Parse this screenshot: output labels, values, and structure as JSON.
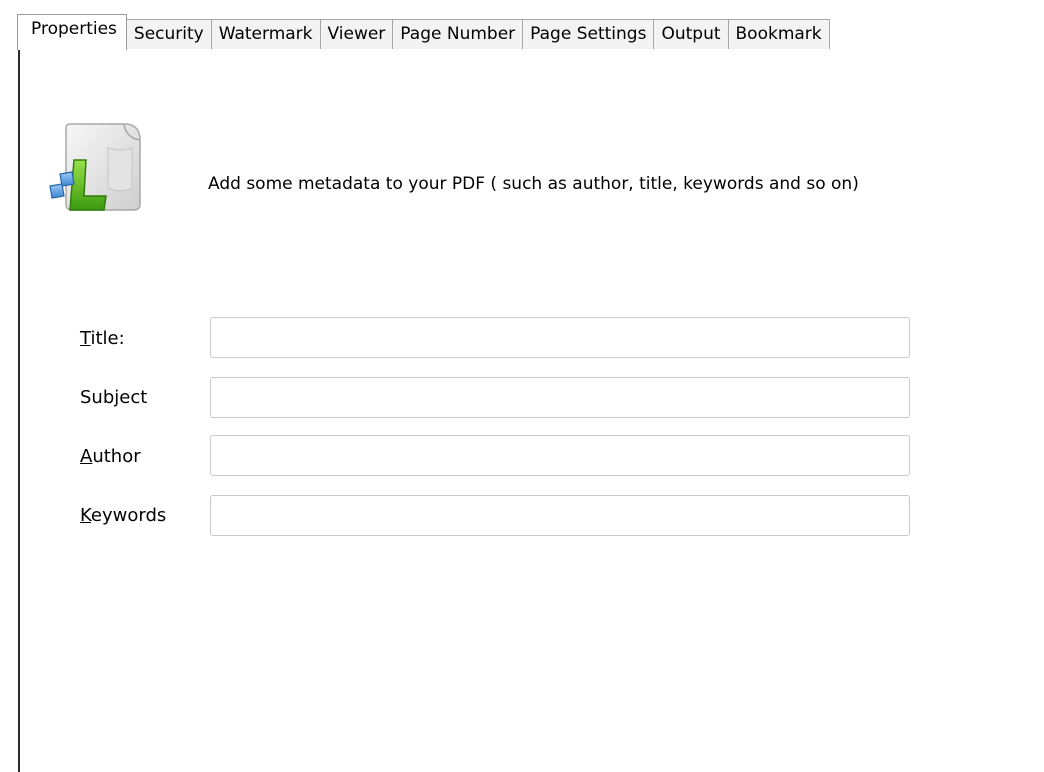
{
  "tabs": [
    {
      "label": "Properties",
      "active": true
    },
    {
      "label": "Security"
    },
    {
      "label": "Watermark"
    },
    {
      "label": "Viewer"
    },
    {
      "label": "Page Number"
    },
    {
      "label": "Page Settings"
    },
    {
      "label": "Output"
    },
    {
      "label": "Bookmark"
    }
  ],
  "panel": {
    "icon": "document-properties-icon",
    "description": "Add some metadata to your PDF ( such as author, title, keywords and so on)"
  },
  "fields": {
    "title": {
      "label_pre": "",
      "label_key": "T",
      "label_post": "itle:",
      "value": ""
    },
    "subject": {
      "label_pre": "Sub",
      "label_key": "j",
      "label_post": "ect",
      "value": ""
    },
    "author": {
      "label_pre": "",
      "label_key": "A",
      "label_post": "uthor",
      "value": ""
    },
    "keywords": {
      "label_pre": "",
      "label_key": "K",
      "label_post": "eywords",
      "value": ""
    }
  }
}
